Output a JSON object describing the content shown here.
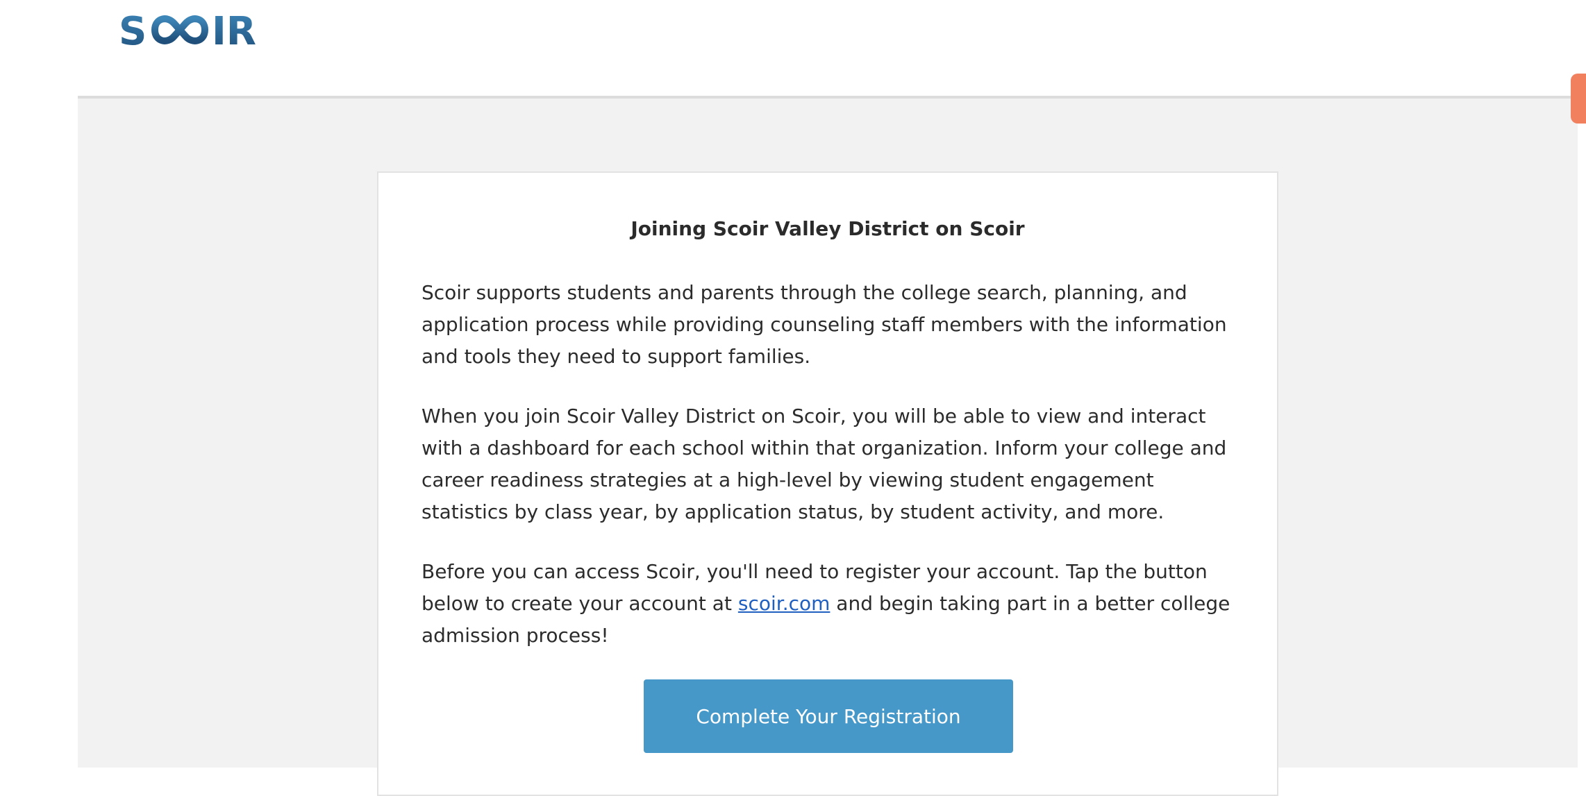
{
  "brand": {
    "logo_text": "SCOIR",
    "primary_color": "#2a6f9e",
    "accent_color": "#f0805e"
  },
  "card": {
    "title": "Joining Scoir Valley District on Scoir",
    "paragraph_1": "Scoir supports students and parents through the college search, planning, and application process while providing counseling staff members with the information and tools they need to support families.",
    "paragraph_2": "When you join Scoir Valley District on Scoir, you will be able to view and interact with a dashboard for each school within that organization. Inform your college and career readiness strategies at a high-level by viewing student engagement statistics by class year, by application status, by student activity, and more.",
    "paragraph_3_before_link": "Before you can access Scoir, you'll need to register your account. Tap the button below to create your account at ",
    "paragraph_3_link": "scoir.com",
    "paragraph_3_after_link": " and begin taking part in a better college admission process!",
    "cta_label": "Complete Your Registration",
    "cta_color": "#4698c9",
    "link_color": "#1f5fbf"
  }
}
